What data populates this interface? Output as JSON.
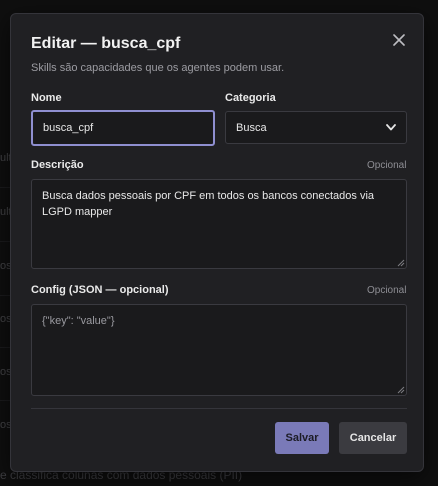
{
  "background": {
    "rows": [
      "ult",
      "ult",
      "os",
      "os",
      "os",
      "os",
      "as"
    ],
    "footer": "e classifica colunas com dados pessoais (PII)"
  },
  "modal": {
    "title": "Editar — busca_cpf",
    "subtitle": "Skills são capacidades que os agentes podem usar.",
    "name": {
      "label": "Nome",
      "value": "busca_cpf"
    },
    "category": {
      "label": "Categoria",
      "selected": "Busca"
    },
    "description": {
      "label": "Descrição",
      "optional": "Opcional",
      "value": "Busca dados pessoais por CPF em todos os bancos conectados via LGPD mapper"
    },
    "config": {
      "label": "Config (JSON — opcional)",
      "optional": "Opcional",
      "placeholder": "{\"key\": \"value\"}",
      "value": ""
    },
    "buttons": {
      "save": "Salvar",
      "cancel": "Cancelar"
    }
  },
  "colors": {
    "accent": "#7a7ab8",
    "focus_ring": "#8f8fd0",
    "modal_bg": "#202023"
  }
}
